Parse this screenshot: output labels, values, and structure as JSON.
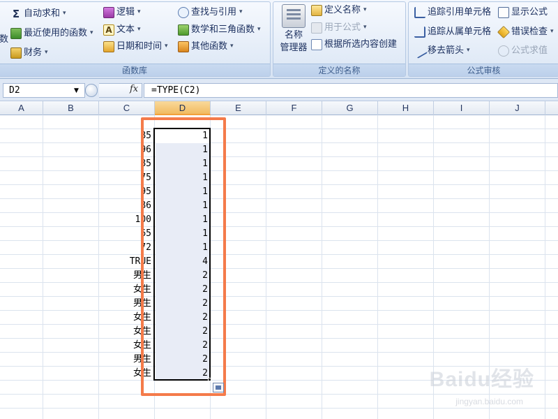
{
  "ribbon": {
    "function_library": {
      "label": "函数库",
      "items": {
        "autosum": "自动求和",
        "recent": "最近使用的函数",
        "finance": "财务",
        "logic": "逻辑",
        "text": "文本",
        "datetime": "日期和时间",
        "lookup": "查找与引用",
        "math": "数学和三角函数",
        "other": "其他函数",
        "cut_left": "数"
      }
    },
    "defined_names": {
      "label": "定义的名称",
      "big_button_line1": "名称",
      "big_button_line2": "管理器",
      "define_name": "定义名称",
      "use_in_formula": "用于公式",
      "create_from_selection": "根据所选内容创建"
    },
    "formula_auditing": {
      "label": "公式审核",
      "trace_precedents": "追踪引用单元格",
      "trace_dependents": "追踪从属单元格",
      "remove_arrows": "移去箭头",
      "show_formulas": "显示公式",
      "error_checking": "错误检查",
      "evaluate_formula": "公式求值"
    },
    "icons": {
      "sigma": "Σ",
      "text_icon": "A",
      "caret": "▾"
    }
  },
  "formula_bar": {
    "name_box": "D2",
    "name_box_caret": "▼",
    "fx": "fx",
    "formula": "=TYPE(C2)"
  },
  "columns": [
    "A",
    "B",
    "C",
    "D",
    "E",
    "F",
    "G",
    "H",
    "I",
    "J"
  ],
  "active_column": "D",
  "data": {
    "column_c": [
      "85",
      "96",
      "85",
      "75",
      "95",
      "86",
      "100",
      "65",
      "72",
      "TRUE",
      "男生",
      "女生",
      "男生",
      "女生",
      "女生",
      "女生",
      "男生",
      "女生"
    ],
    "column_d": [
      "1",
      "1",
      "1",
      "1",
      "1",
      "1",
      "1",
      "1",
      "1",
      "4",
      "2",
      "2",
      "2",
      "2",
      "2",
      "2",
      "2",
      "2"
    ]
  },
  "watermark": {
    "main": "Baidu经验",
    "sub": "jingyan.baidu.com"
  },
  "colors": {
    "highlight_frame": "#f47b4a",
    "active_header": "#f1bb61",
    "selection_fill": "#e8ecf6"
  }
}
